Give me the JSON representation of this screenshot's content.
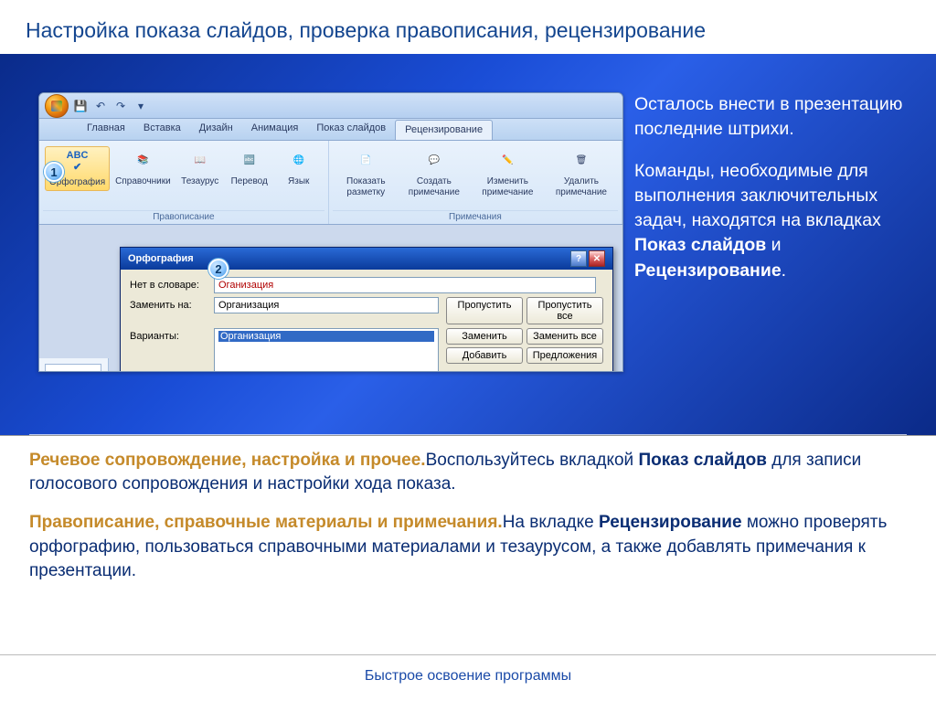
{
  "slide_title": "Настройка показа слайдов, проверка правописания, рецензирование",
  "right_text": {
    "p1": "Осталось внести в презентацию последние штрихи.",
    "p2_a": "Команды, необходимые для выполнения заключительных задач, находятся на вкладках ",
    "p2_b1": "Показ слайдов",
    "p2_mid": " и ",
    "p2_b2": "Рецензирование",
    "p2_end": "."
  },
  "office": {
    "tabs": [
      "Главная",
      "Вставка",
      "Дизайн",
      "Анимация",
      "Показ слайдов",
      "Рецензирование"
    ],
    "active_tab": 5,
    "groups": {
      "proofing": {
        "label": "Правописание",
        "buttons": [
          "Орфография",
          "Справочники",
          "Тезаурус",
          "Перевод",
          "Язык"
        ]
      },
      "comments": {
        "label": "Примечания",
        "buttons": [
          "Показать разметку",
          "Создать примечание",
          "Изменить примечание",
          "Удалить примечание"
        ]
      }
    },
    "callouts": {
      "c1": "1",
      "c2": "2"
    }
  },
  "dialog": {
    "title": "Орфография",
    "rows": {
      "not_in_dict": "Нет в словаре:",
      "not_in_dict_val": "Оганизация",
      "replace": "Заменить на:",
      "replace_val": "Организация",
      "variants": "Варианты:",
      "variant_item": "Организация"
    },
    "buttons": {
      "skip": "Пропустить",
      "skip_all": "Пропустить все",
      "change": "Заменить",
      "change_all": "Заменить все",
      "add": "Добавить",
      "suggest": "Предложения"
    }
  },
  "body": {
    "p1_gold": "Речевое сопровождение, настройка и прочее.",
    "p1_a": "Воспользуйтесь вкладкой ",
    "p1_b": "Показ слайдов",
    "p1_c": " для записи голосового сопровождения и настройки хода показа.",
    "p2_gold": "Правописание, справочные материалы и примечания.",
    "p2_a": "На вкладке ",
    "p2_b": "Рецензирование",
    "p2_c": " можно проверять орфографию, пользоваться справочными материалами и тезаурусом, а также добавлять примечания к презентации."
  },
  "footer": "Быстрое освоение программы"
}
